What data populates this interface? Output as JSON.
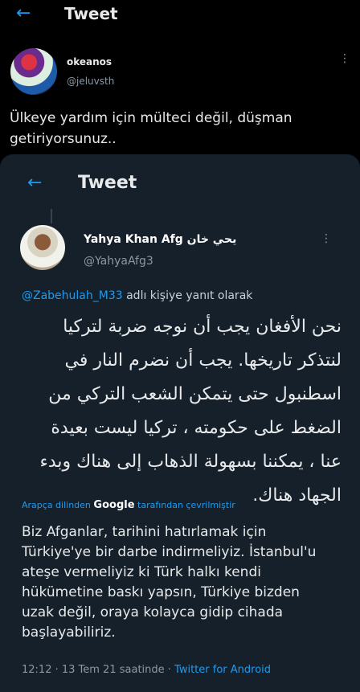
{
  "outer": {
    "title": "Tweet",
    "author_name": "okeanos",
    "author_handle": "@jeluvsth",
    "text": "Ülkeye yardım için mülteci değil, düşman getiriyorsunuz.."
  },
  "inner": {
    "title": "Tweet",
    "author_name": "Yahya Khan Afg يحي خان",
    "author_handle": "@YahyaAfg3",
    "reply_mention": "@Zabehulah_M33",
    "reply_suffix": " adlı kişiye yanıt olarak",
    "arabic_text": "نحن الأفغان يجب أن نوجه ضربة لتركيا لنتذكر تاريخها. يجب أن نضرم النار في اسطنبول حتى يتمكن الشعب التركي من الضغط على حكومته ، تركيا ليست بعيدة عنا ، يمكننا بسهولة الذهاب إلى هناك وبدء الجهاد هناك.",
    "translate_prefix": "Arapça dilinden ",
    "translate_google": "Google",
    "translate_suffix": " tarafından çevrilmiştir",
    "translation": "Biz Afganlar, tarihini hatırlamak için Türkiye'ye bir darbe indirmeliyiz. İstanbul'u ateşe vermeliyiz ki Türk halkı kendi hükümetine baskı yapsın, Türkiye bizden uzak değil, oraya kolayca gidip cihada başlayabiliriz.",
    "timestamp": "12:12 · 13 Tem 21 saatinde · ",
    "source": "Twitter for Android"
  }
}
